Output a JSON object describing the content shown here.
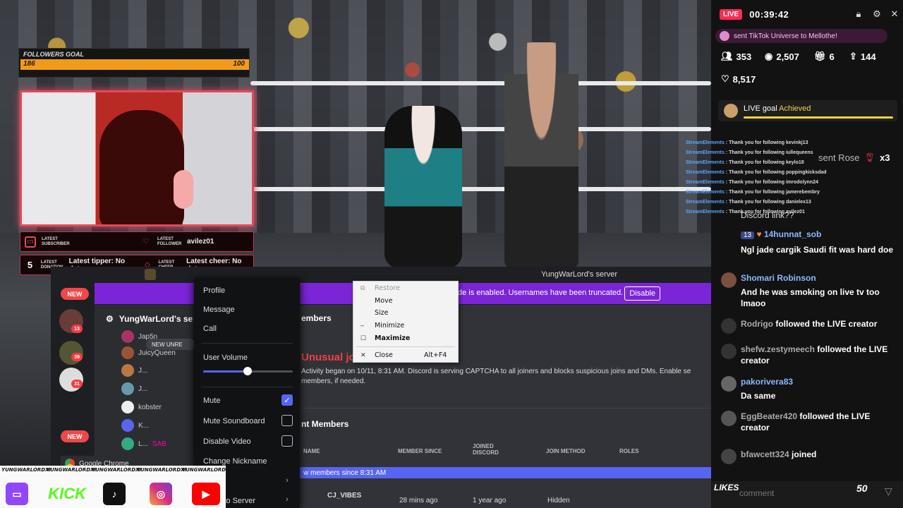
{
  "overlay": {
    "followers_goal": {
      "title": "FOLLOWERS GOAL",
      "current": "186",
      "target": "100"
    },
    "latest": {
      "subscriber_label": "LATEST SUBSCRIBER",
      "follower_label": "LATEST FOLLOWER",
      "follower_value": "avilez01",
      "donation_label": "LATEST DONATION",
      "tipper_text": "Latest tipper: No data",
      "cheer_label": "LATEST CHEER",
      "cheer_text": "Latest cheer: No data"
    }
  },
  "discord": {
    "server_name": "YungWarLord's server",
    "banner_text": "de is enabled. Usernames have been truncated.",
    "banner_button": "Disable",
    "channel_header": "YungWarLord's se",
    "members_header": "embers",
    "new_label": "NEW",
    "new_unread": "NEW UNRE",
    "server_badges": [
      "13",
      "39",
      "31"
    ],
    "members": [
      "Jap5n",
      "JuicyQueen",
      "J...",
      "J...",
      "kobster",
      "K...",
      "L..."
    ],
    "member_tag": "SAB",
    "raid_title": "Unusual jo",
    "raid_text": "Activity began on 10/11, 8:31 AM. Discord is serving CAPTCHA to all joiners and blocks suspicious joins and DMs. Enable se",
    "raid_text2": "members, if needed.",
    "section_title": "nt Members",
    "table_headers": [
      "NAME",
      "MEMBER SINCE",
      "JOINED DISCORD",
      "JOIN METHOD",
      "ROLES"
    ],
    "new_since": "w members since 8:31 AM",
    "row": {
      "name": "CJ_VIBES",
      "member_since": "28 mins ago",
      "joined": "1 year ago",
      "method": "Hidden"
    },
    "taskbar_text": "Google Chrome"
  },
  "context_menu": {
    "items": [
      "Profile",
      "Message",
      "Call"
    ],
    "user_volume": "User Volume",
    "volume_level": 0.5,
    "mute": "Mute",
    "mute_soundboard": "Mute Soundboard",
    "disable_video": "Disable Video",
    "change_nickname": "Change Nickname",
    "invite": "Invite to Server"
  },
  "window_menu": {
    "restore": "Restore",
    "move": "Move",
    "size": "Size",
    "minimize": "Minimize",
    "maximize": "Maximize",
    "close": "Close",
    "close_shortcut": "Alt+F4"
  },
  "socials": {
    "handle": "YUNGWARLORDXI",
    "kick": "KICK"
  },
  "tiktok": {
    "live_label": "LIVE",
    "timer": "00:39:42",
    "gift_text": "sent TikTok Universe to Mellothe!",
    "stats": {
      "viewers": "353",
      "views": "2,507",
      "gifts": "6",
      "shares": "144",
      "likes": "8,517"
    },
    "goal_label": "LIVE goal",
    "goal_status": "Achieved",
    "streamelements": [
      "Thank you for following kevinkj13",
      "Thank you for following iullequeens",
      "Thank you for following keylo18",
      "Thank you for following poppingkicksdad",
      "Thank you for following imrodolynn24",
      "Thank you for following jamerebembry",
      "Thank you for following danielex13",
      "Thank you for following avilez01"
    ],
    "se_name": "StreamElements",
    "rose_text": "sent Rose",
    "rose_count": "x3",
    "discord_link": "Discord link??",
    "chat": [
      {
        "user": "14hunnat_sob",
        "level": "13",
        "text": "Ngl jade cargik Saudi fit was hard doe"
      },
      {
        "user": "Shomari Robinson",
        "text": "And he was smoking on live tv too lmaoo"
      },
      {
        "user": "Rodrigo",
        "event": "followed the LIVE creator"
      },
      {
        "user": "shefw.zestymeech",
        "event": "followed the LIVE creator"
      },
      {
        "user": "pakorivera83",
        "text": "Da same"
      },
      {
        "user": "EggBeater420",
        "event": "followed the LIVE creator"
      },
      {
        "user": "bfawcett324",
        "event": "joined"
      }
    ],
    "comment_placeholder": "comment",
    "likes_overlay": "LIKES",
    "likes_number": "50"
  },
  "colors": {
    "accent_red": "#e4485a",
    "discord_purple": "#7c25d8",
    "tiktok_pink": "#fe2c55",
    "goal_orange": "#f29b1b"
  }
}
